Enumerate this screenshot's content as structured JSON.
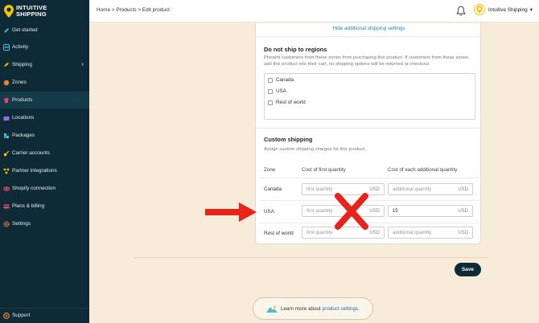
{
  "brand": {
    "line1": "INTUITIVE",
    "line2": "SHIPPING"
  },
  "sidebar": {
    "items": [
      {
        "label": "Get started",
        "icon": "rocket-icon"
      },
      {
        "label": "Activity",
        "icon": "activity-icon"
      },
      {
        "label": "Shipping",
        "icon": "shipping-icon",
        "chevron": "›"
      },
      {
        "label": "Zones",
        "icon": "zones-icon"
      },
      {
        "label": "Products",
        "icon": "products-icon"
      },
      {
        "label": "Locations",
        "icon": "locations-icon"
      },
      {
        "label": "Packages",
        "icon": "packages-icon"
      },
      {
        "label": "Carrier accounts",
        "icon": "key-icon"
      },
      {
        "label": "Partner integrations",
        "icon": "integrations-icon"
      },
      {
        "label": "Shopify connection",
        "icon": "shopify-icon"
      },
      {
        "label": "Plans & billing",
        "icon": "billing-icon"
      },
      {
        "label": "Settings",
        "icon": "gear-icon"
      }
    ],
    "active": "Products",
    "support": "Support"
  },
  "topbar": {
    "breadcrumb": "Home > Products > Edit product",
    "user_name": "Intuitive Shipping",
    "user_caret": "▾"
  },
  "card": {
    "hide_link": "Hide additional shipping settings",
    "regions": {
      "title": "Do not ship to regions",
      "description": "Prevent customers from these zones from purchasing this product. If customers from these zones add this product into their cart, no shipping options will be returned at checkout.",
      "options": [
        "Canada",
        "USA",
        "Rest of world"
      ]
    },
    "custom": {
      "title": "Custom shipping",
      "description": "Assign custom shipping charges for this product.",
      "col_zone": "Zone",
      "col_first": "Cost of first quantity",
      "col_additional": "Cost of each additional quantity",
      "unit": "USD",
      "rows": [
        {
          "zone": "Canada",
          "first_placeholder": "first quantity",
          "first_value": "",
          "add_placeholder": "additional quantity",
          "add_value": ""
        },
        {
          "zone": "USA",
          "first_placeholder": "first quantity",
          "first_value": "",
          "add_placeholder": "",
          "add_value": "15"
        },
        {
          "zone": "Rest of world",
          "first_placeholder": "first quantity",
          "first_value": "",
          "add_placeholder": "additional quantity",
          "add_value": ""
        }
      ]
    }
  },
  "save_label": "Save",
  "learn": {
    "text": "Learn more about",
    "link": "product settings."
  },
  "colors": {
    "sidebar": "#0d2a36",
    "accent": "#1e88a8",
    "annotation": "#e8231a",
    "background": "#f6ecd9"
  }
}
